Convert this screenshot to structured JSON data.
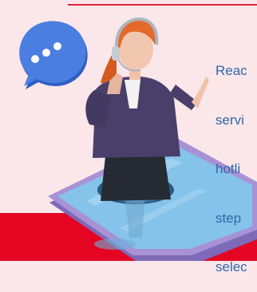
{
  "text_lines": [
    "Reac",
    "servi",
    "hotli",
    "step",
    "selec"
  ],
  "colors": {
    "background": "#fbe7ea",
    "accent_red": "#e40522",
    "text_blue": "#2e69a8",
    "phone_frame": "#9b85c9",
    "phone_screen": "#82bfe6",
    "bubble": "#3f6fd3",
    "hair": "#e36a2a",
    "jacket": "#4a3f6b"
  },
  "icons": {
    "speech_bubble": "speech-bubble-icon",
    "headset": "headset-icon"
  }
}
